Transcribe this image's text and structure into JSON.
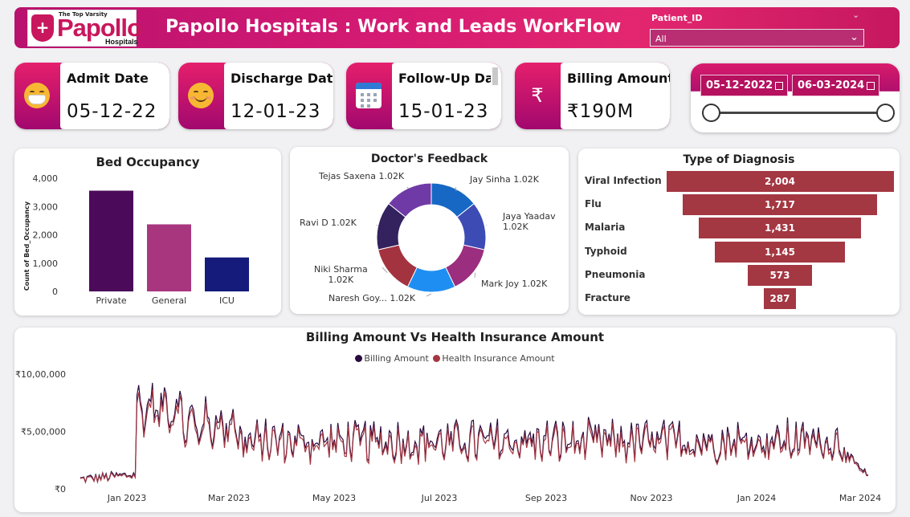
{
  "header": {
    "logo_tagline": "The Top Varsity",
    "logo_name": "Papollo",
    "logo_subname": "Hospitals",
    "title": "Papollo Hospitals : Work and Leads WorkFlow",
    "patient_filter": {
      "label": "Patient_ID",
      "value": "All"
    },
    "colors": {
      "brand": "#c8175d",
      "accent": "#a2086e"
    }
  },
  "kpis": [
    {
      "label": "Admit Date",
      "value": "05-12-22",
      "icon": "mask-face-icon"
    },
    {
      "label": "Discharge Date",
      "value": "12-01-23",
      "icon": "smile-face-icon"
    },
    {
      "label": "Follow-Up Date",
      "value": "15-01-23",
      "icon": "calendar-icon"
    },
    {
      "label": "Billing Amount",
      "value": "₹190M",
      "icon": "rupee-icon"
    }
  ],
  "date_slicer": {
    "start": "05-12-2022",
    "end": "06-03-2024"
  },
  "bed_occupancy": {
    "title": "Bed Occupancy",
    "chart_data": {
      "type": "bar",
      "categories": [
        "Private",
        "General",
        "ICU"
      ],
      "values": [
        3560,
        2370,
        1200
      ],
      "colors": [
        "#4b0a5a",
        "#a8367f",
        "#141b7a"
      ],
      "ylabel": "Count of Bed_Occupancy",
      "ylim": [
        0,
        4000
      ],
      "yticks": [
        "0",
        "1,000",
        "2,000",
        "3,000",
        "4,000"
      ]
    }
  },
  "doctors_feedback": {
    "title": "Doctor's Feedback",
    "chart_data": {
      "type": "pie",
      "slices": [
        {
          "label": "Jay Sinha",
          "display": "1.02K",
          "value": 1020,
          "color": "#1668c4"
        },
        {
          "label": "Jaya Yaadav",
          "display": "1.02K",
          "value": 1020,
          "color": "#3d4bb4"
        },
        {
          "label": "Mark Joy",
          "display": "1.02K",
          "value": 1020,
          "color": "#9b2e7e"
        },
        {
          "label": "Naresh Goy...",
          "display": "1.02K",
          "value": 1020,
          "color": "#1f8ef3"
        },
        {
          "label": "Niki Sharma",
          "display": "1.02K",
          "value": 1020,
          "color": "#a3333f"
        },
        {
          "label": "Ravi D",
          "display": "1.02K",
          "value": 1020,
          "color": "#33225e"
        },
        {
          "label": "Tejas Saxena",
          "display": "1.02K",
          "value": 1020,
          "color": "#6f3aa6"
        }
      ]
    }
  },
  "diagnosis": {
    "title": "Type of Diagnosis",
    "chart_data": {
      "type": "bar",
      "categories": [
        "Viral Infection",
        "Flu",
        "Malaria",
        "Typhoid",
        "Pneumonia",
        "Fracture"
      ],
      "values": [
        2004,
        1717,
        1431,
        1145,
        573,
        287
      ],
      "labels": [
        "2,004",
        "1,717",
        "1,431",
        "1,145",
        "573",
        "287"
      ],
      "color": "#a33742"
    }
  },
  "billing_vs_insurance": {
    "title": "Billing Amount Vs Health Insurance Amount",
    "chart_data": {
      "type": "line",
      "series": [
        {
          "name": "Billing Amount",
          "color": "#2a0a3e"
        },
        {
          "name": "Health Insurance Amount",
          "color": "#a33742"
        }
      ],
      "yticks": [
        "₹0",
        "₹5,00,000",
        "₹10,00,000"
      ],
      "ylim": [
        0,
        1000000
      ],
      "xticks": [
        "Jan 2023",
        "Mar 2023",
        "May 2023",
        "Jul 2023",
        "Sep 2023",
        "Nov 2023",
        "Jan 2024",
        "Mar 2024"
      ]
    }
  }
}
